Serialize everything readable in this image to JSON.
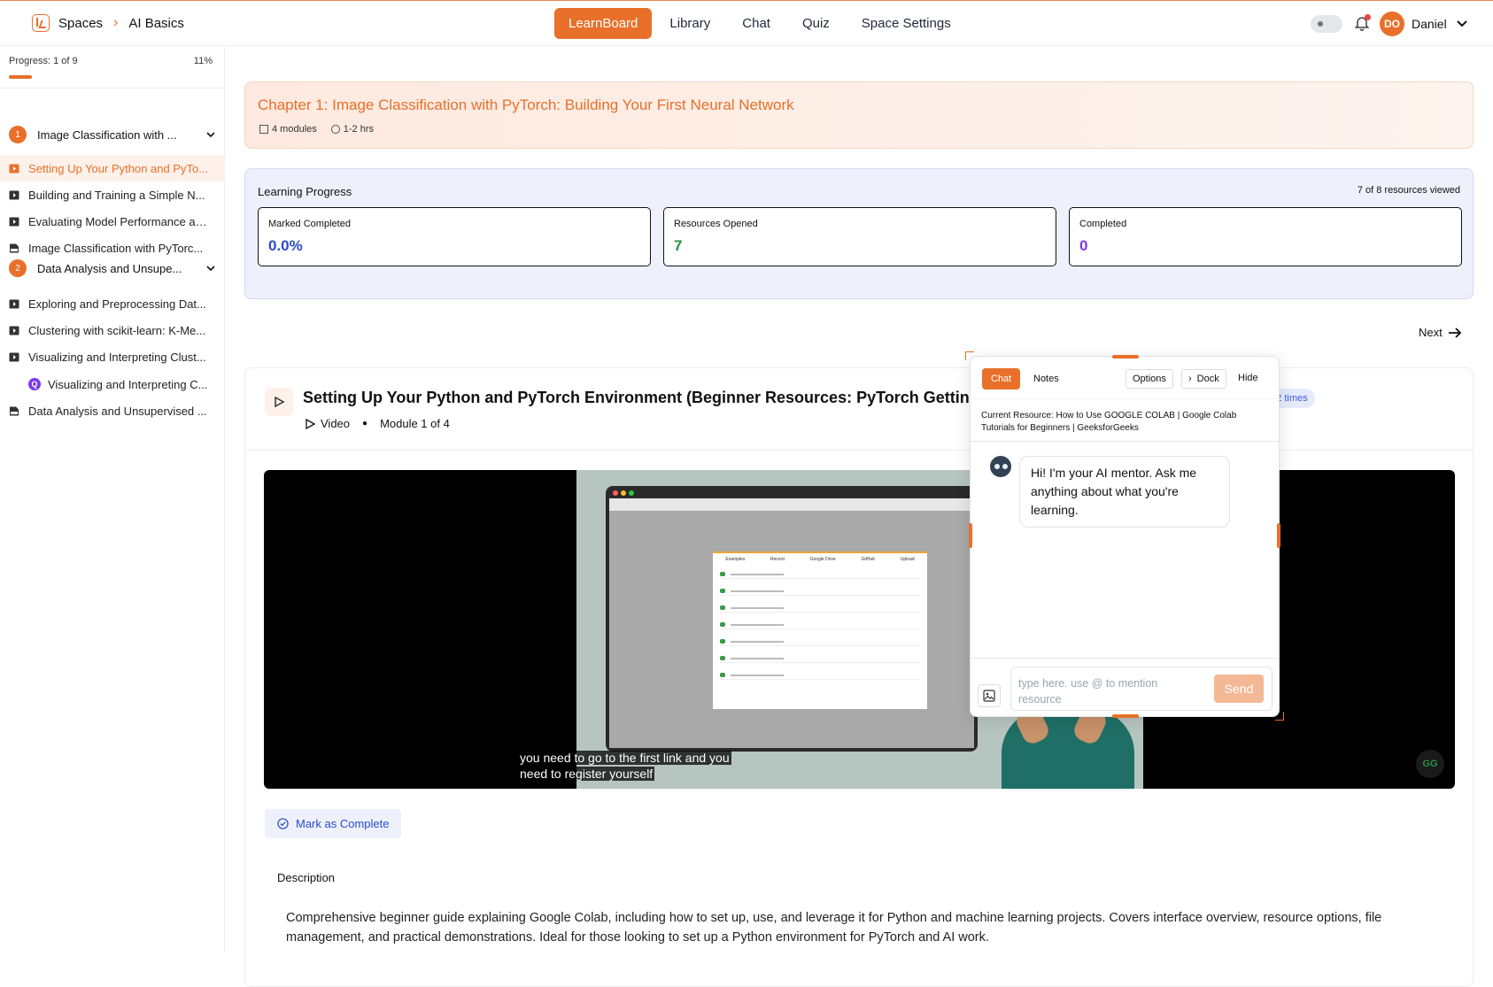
{
  "breadcrumb": {
    "root": "Spaces",
    "current": "AI Basics"
  },
  "nav": {
    "items": [
      "LearnBoard",
      "Library",
      "Chat",
      "Quiz",
      "Space Settings"
    ],
    "active": "LearnBoard"
  },
  "user": {
    "initials": "DO",
    "name": "Daniel"
  },
  "sidebar": {
    "progress_label": "Progress: 1 of 9",
    "progress_percent": "11%",
    "progress_fraction": 0.11,
    "chapters": [
      {
        "num": "1",
        "title": "Image Classification with ..."
      },
      {
        "num": "2",
        "title": "Data Analysis and Unsupe..."
      }
    ],
    "modules": [
      {
        "title": "Setting Up Your Python and PyTo...",
        "type": "video",
        "active": true
      },
      {
        "title": "Building and Training a Simple N...",
        "type": "video"
      },
      {
        "title": "Evaluating Model Performance an...",
        "type": "video"
      },
      {
        "title": "Image Classification with PyTorc...",
        "type": "pdf"
      },
      {
        "title": "Exploring and Preprocessing Dat...",
        "type": "video"
      },
      {
        "title": "Clustering with scikit-learn: K-Me...",
        "type": "video"
      },
      {
        "title": "Visualizing and Interpreting Clust...",
        "type": "video"
      },
      {
        "title": "Visualizing and Interpreting C...",
        "type": "quiz",
        "badge": "Q"
      },
      {
        "title": "Data Analysis and Unsupervised ...",
        "type": "pdf"
      }
    ]
  },
  "chapter": {
    "title": "Chapter 1: Image Classification with PyTorch: Building Your First Neural Network",
    "modules": "4 modules",
    "duration": "1-2 hrs"
  },
  "learning_progress": {
    "title": "Learning Progress",
    "summary": "7 of 8 resources viewed",
    "stats": [
      {
        "label": "Marked Completed",
        "value": "0.0%",
        "color": "#2b4acb"
      },
      {
        "label": "Resources Opened",
        "value": "7",
        "color": "#2f8d46"
      },
      {
        "label": "Completed",
        "value": "0",
        "color": "#7c3aed"
      }
    ]
  },
  "next_label": "Next",
  "resource": {
    "title": "Setting Up Your Python and PyTorch Environment (Beginner Resources: PyTorch Getting",
    "type": "Video",
    "module": "Module 1 of 4",
    "viewed_badge": "d 2 times",
    "subtitle_line1": "you need to go to the first link and you",
    "subtitle_line2": "need to register yourself",
    "mark_complete": "Mark as Complete",
    "description_label": "Description",
    "description": "Comprehensive beginner guide explaining Google Colab, including how to set up, use, and leverage it for Python and machine learning projects. Covers interface overview, resource options, file management, and practical demonstrations. Ideal for those looking to set up a Python environment for PyTorch and AI work."
  },
  "video_ui": {
    "dialog_tabs": [
      "Examples",
      "Recent",
      "Google Drive",
      "GitHub",
      "Upload"
    ],
    "watermark": "GG"
  },
  "chat": {
    "tab_chat": "Chat",
    "tab_notes": "Notes",
    "options": "Options",
    "dock": "Dock",
    "hide": "Hide",
    "current_resource": "Current Resource: How to Use GOOGLE COLAB | Google Colab Tutorials for Beginners | GeeksforGeeks",
    "greeting": "Hi! I'm your AI mentor. Ask me anything about what you're learning.",
    "placeholder": "type here. use @ to mention resource",
    "send": "Send"
  },
  "colors": {
    "accent": "#e8702a",
    "blue": "#2b4acb",
    "green": "#2f8d46",
    "purple": "#7c3aed"
  }
}
